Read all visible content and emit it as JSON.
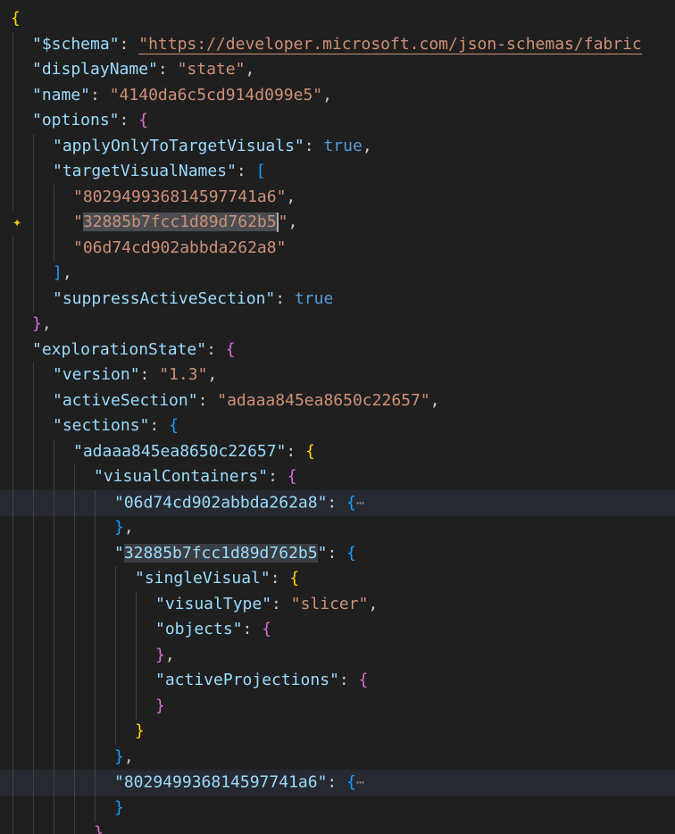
{
  "editor": {
    "schema_key": "\"$schema\"",
    "schema_value": "\"https://developer.microsoft.com/json-schemas/fabric",
    "displayName_key": "\"displayName\"",
    "displayName_value": "\"state\"",
    "name_key": "\"name\"",
    "name_value": "\"4140da6c5cd914d099e5\"",
    "options_key": "\"options\"",
    "applyOnly_key": "\"applyOnlyToTargetVisuals\"",
    "applyOnly_value": "true",
    "targetVisualNames_key": "\"targetVisualNames\"",
    "tv_1": "\"802949936814597741a6\"",
    "tv_2_pre": "\"",
    "tv_2_sel": "32885b7fcc1d89d762b5",
    "tv_2_post": "\"",
    "tv_3": "\"06d74cd902abbda262a8\"",
    "suppress_key": "\"suppressActiveSection\"",
    "suppress_value": "true",
    "exploration_key": "\"explorationState\"",
    "version_key": "\"version\"",
    "version_value": "\"1.3\"",
    "activeSection_key": "\"activeSection\"",
    "activeSection_value": "\"adaaa845ea8650c22657\"",
    "sections_key": "\"sections\"",
    "section_id_key": "\"adaaa845ea8650c22657\"",
    "visualContainers_key": "\"visualContainers\"",
    "vc_1_key": "\"06d74cd902abbda262a8\"",
    "vc_2_pre": "\"",
    "vc_2_sel": "32885b7fcc1d89d762b5",
    "vc_2_post": "\"",
    "singleVisual_key": "\"singleVisual\"",
    "visualType_key": "\"visualType\"",
    "visualType_value": "\"slicer\"",
    "objects_key": "\"objects\"",
    "activeProjections_key": "\"activeProjections\"",
    "vc_3_key": "\"802949936814597741a6\"",
    "fold_glyph": "⋯",
    "sparkle_glyph": "✦"
  },
  "colors": {
    "background": "#1f1f1f",
    "key": "#9cdcfe",
    "string": "#ce9178",
    "keyword": "#569cd6",
    "bracket_gold": "#ffd700",
    "bracket_orchid": "#da70d6",
    "bracket_blue": "#179fff"
  }
}
